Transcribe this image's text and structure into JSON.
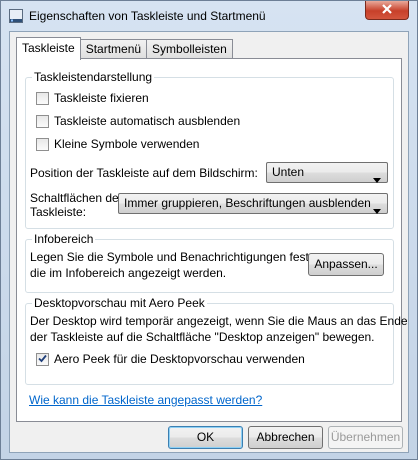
{
  "window": {
    "title": "Eigenschaften von Taskleiste und Startmenü"
  },
  "tabs": [
    {
      "label": "Taskleiste",
      "active": true
    },
    {
      "label": "Startmenü",
      "active": false
    },
    {
      "label": "Symbolleisten",
      "active": false
    }
  ],
  "appearance": {
    "legend": "Taskleistendarstellung",
    "options": [
      {
        "label": "Taskleiste fixieren",
        "checked": false
      },
      {
        "label": "Taskleiste automatisch ausblenden",
        "checked": false
      },
      {
        "label": "Kleine Symbole verwenden",
        "checked": false
      }
    ],
    "position_label": "Position der Taskleiste auf dem Bildschirm:",
    "position_value": "Unten",
    "buttons_label_line1": "Schaltflächen der",
    "buttons_label_line2": "Taskleiste:",
    "buttons_value": "Immer gruppieren, Beschriftungen ausblenden"
  },
  "notification_area": {
    "legend": "Infobereich",
    "text_line1": "Legen Sie die Symbole und Benachrichtigungen fest,",
    "text_line2": "die im Infobereich angezeigt werden.",
    "customize_label": "Anpassen..."
  },
  "aero_peek": {
    "legend": "Desktopvorschau mit Aero Peek",
    "text_line1": "Der Desktop wird temporär angezeigt, wenn Sie die Maus an das Ende",
    "text_line2": "der Taskleiste auf die Schaltfläche \"Desktop anzeigen\" bewegen.",
    "option_label": "Aero Peek für die Desktopvorschau verwenden",
    "option_checked": true
  },
  "help_link": "Wie kann die Taskleiste angepasst werden?",
  "footer": {
    "ok_label": "OK",
    "cancel_label": "Abbrechen",
    "apply_label": "Übernehmen"
  },
  "icons": {
    "window": "taskbar-properties-icon",
    "close": "close-icon",
    "dropdown": "chevron-down-icon",
    "check": "checkmark-icon"
  }
}
